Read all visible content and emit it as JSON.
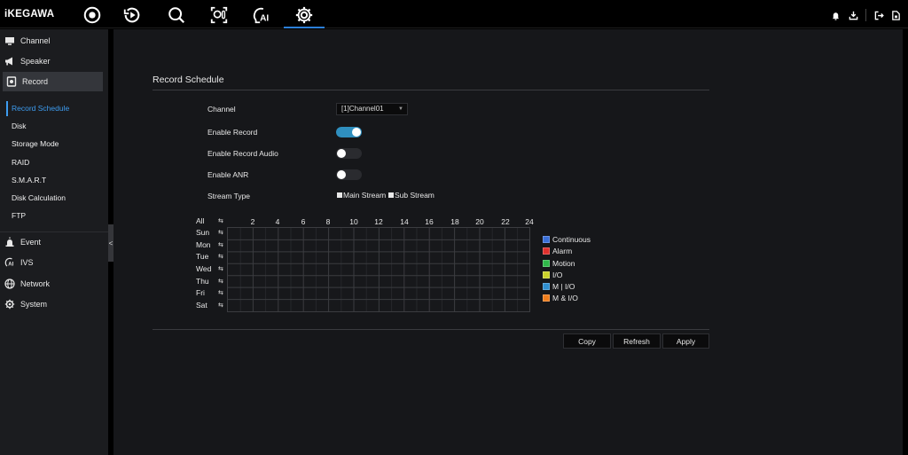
{
  "app": {
    "brand": "iKEGAWA"
  },
  "top_nav": [
    {
      "name": "live-view-icon",
      "active": false
    },
    {
      "name": "playback-icon",
      "active": false
    },
    {
      "name": "search-icon",
      "active": false
    },
    {
      "name": "face-temperature-icon",
      "active": false
    },
    {
      "name": "ai-icon",
      "active": false
    },
    {
      "name": "settings-gear-icon",
      "active": true
    }
  ],
  "top_right": [
    "bell-icon",
    "download-icon",
    "logout-icon",
    "file-icon"
  ],
  "sidebar": {
    "items": [
      {
        "label": "Channel",
        "icon": "monitor-icon"
      },
      {
        "label": "Speaker",
        "icon": "megaphone-icon"
      },
      {
        "label": "Record",
        "icon": "record-icon",
        "active": true
      },
      {
        "label": "Event",
        "icon": "alarm-icon"
      },
      {
        "label": "IVS",
        "icon": "ai-head-icon"
      },
      {
        "label": "Network",
        "icon": "globe-icon"
      },
      {
        "label": "System",
        "icon": "gear-icon"
      }
    ],
    "record_sub": [
      {
        "label": "Record Schedule",
        "active": true
      },
      {
        "label": "Disk"
      },
      {
        "label": "Storage Mode"
      },
      {
        "label": "RAID"
      },
      {
        "label": "S.M.A.R.T"
      },
      {
        "label": "Disk Calculation"
      },
      {
        "label": "FTP"
      }
    ],
    "collapse_label": "<"
  },
  "page": {
    "title": "Record Schedule",
    "channel_label": "Channel",
    "channel_value": "[1]Channel01",
    "enable_record_label": "Enable Record",
    "enable_record": true,
    "enable_record_audio_label": "Enable Record Audio",
    "enable_record_audio": false,
    "enable_anr_label": "Enable ANR",
    "enable_anr": false,
    "stream_type_label": "Stream Type",
    "main_stream_label": "Main Stream",
    "sub_stream_label": "Sub Stream",
    "main_stream_checked": true,
    "sub_stream_checked": true
  },
  "schedule": {
    "rows": [
      "All",
      "Sun",
      "Mon",
      "Tue",
      "Wed",
      "Thu",
      "Fri",
      "Sat"
    ],
    "hours": [
      "2",
      "4",
      "6",
      "8",
      "10",
      "12",
      "14",
      "16",
      "18",
      "20",
      "22",
      "24"
    ],
    "legend": [
      {
        "label": "Continuous",
        "color": "#3a6fd8"
      },
      {
        "label": "Alarm",
        "color": "#e0302d"
      },
      {
        "label": "Motion",
        "color": "#2fb94a"
      },
      {
        "label": "I/O",
        "color": "#c9d12a"
      },
      {
        "label": "M | I/O",
        "color": "#2f8fd0"
      },
      {
        "label": "M & I/O",
        "color": "#f07d1c"
      }
    ]
  },
  "buttons": {
    "copy": "Copy",
    "refresh": "Refresh",
    "apply": "Apply"
  }
}
